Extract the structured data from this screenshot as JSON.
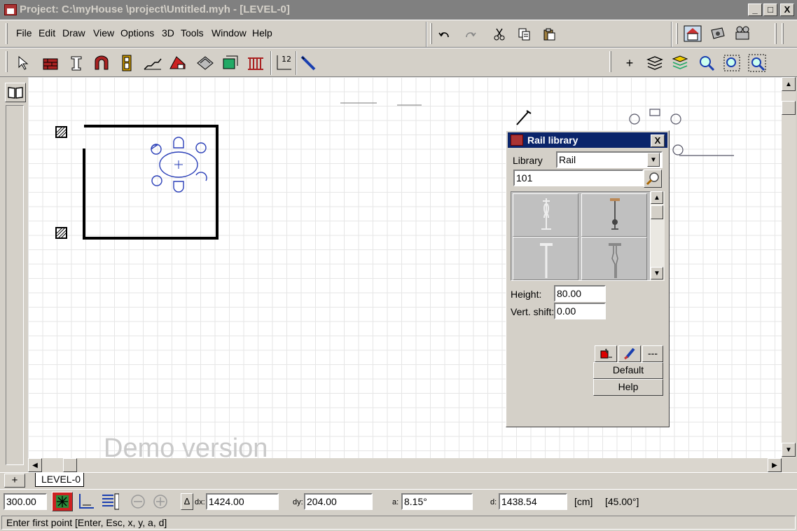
{
  "window": {
    "title": "Project: C:\\myHouse \\project\\Untitled.myh - [LEVEL-0]",
    "minimize": "_",
    "maximize": "□",
    "close": "X"
  },
  "menu": [
    "File",
    "Edit",
    "Draw",
    "View",
    "Options",
    "3D",
    "Tools",
    "Window",
    "Help"
  ],
  "toolbar": {
    "dim_superscript": "12",
    "plus": "+"
  },
  "canvas": {
    "watermark": "Demo version"
  },
  "tabs": {
    "add": "+",
    "level": "LEVEL-0"
  },
  "dialog": {
    "title": "Rail library",
    "close": "X",
    "library_label": "Library",
    "library_value": "Rail",
    "search_value": "101",
    "height_label": "Height:",
    "height_value": "80.00",
    "vshift_label": "Vert. shift:",
    "vshift_value": "0.00",
    "more_label": "---",
    "default_label": "Default",
    "help_label": "Help"
  },
  "coords": {
    "step": "300.00",
    "dx_label": "dx:",
    "dx": "1424.00",
    "dy_label": "dy:",
    "dy": "204.00",
    "a_label": "a:",
    "a": "8.15°",
    "d_label": "d:",
    "d": "1438.54",
    "unit": "[cm]",
    "angle": "[45.00°]",
    "delta": "Δ"
  },
  "status": {
    "text": "Enter first point [Enter, Esc, x, y, a, d]"
  },
  "colors": {
    "title_inactive": "#808080",
    "dialog_title": "#0a246a",
    "furniture": "#2a3fb8"
  }
}
